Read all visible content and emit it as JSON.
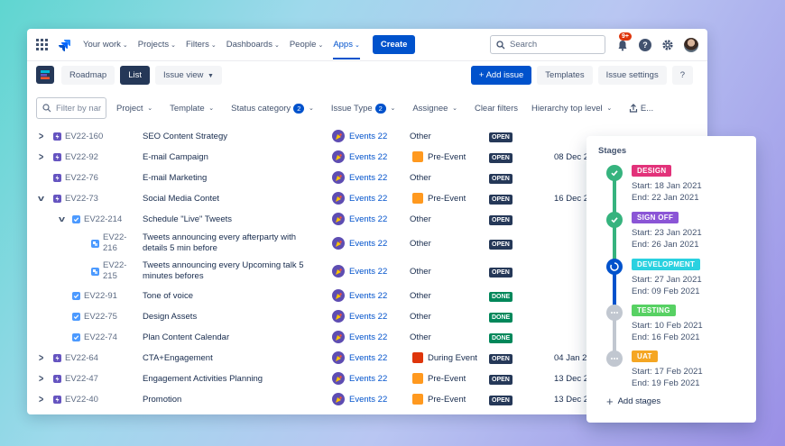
{
  "nav": {
    "items": [
      "Your work",
      "Projects",
      "Filters",
      "Dashboards",
      "People",
      "Apps"
    ],
    "create": "Create",
    "search_placeholder": "Search",
    "notif_count": "9+",
    "help": "?"
  },
  "toolbar": {
    "roadmap": "Roadmap",
    "list": "List",
    "issue_view": "Issue view",
    "add_issue": "+ Add issue",
    "templates": "Templates",
    "issue_settings": "Issue settings",
    "help": "?"
  },
  "filters": {
    "placeholder": "Filter by nar",
    "project": "Project",
    "template": "Template",
    "status_category": "Status category",
    "status_count": "2",
    "issue_type": "Issue Type",
    "issue_type_count": "2",
    "assignee": "Assignee",
    "clear": "Clear filters",
    "hierarchy": "Hierarchy top level",
    "export": "E..."
  },
  "rows": [
    {
      "expand": ">",
      "key": "EV22-160",
      "type": "epic",
      "summary": "SEO Content Strategy",
      "project": "Events 22",
      "template": "Other",
      "status": "OPEN",
      "date": ""
    },
    {
      "expand": ">",
      "key": "EV22-92",
      "type": "epic",
      "summary": "E-mail Campaign",
      "project": "Events 22",
      "template": "Pre-Event",
      "status": "OPEN",
      "date": "08 Dec 2"
    },
    {
      "expand": "",
      "key": "EV22-76",
      "type": "epic",
      "summary": "E-mail Marketing",
      "project": "Events 22",
      "template": "Other",
      "status": "OPEN",
      "date": ""
    },
    {
      "expand": "v",
      "key": "EV22-73",
      "type": "epic",
      "summary": "Social Media Contet",
      "project": "Events 22",
      "template": "Pre-Event",
      "status": "OPEN",
      "date": "16 Dec 2"
    },
    {
      "expand": "v",
      "key": "EV22-214",
      "type": "task",
      "summary": "Schedule \"Live\" Tweets",
      "project": "Events 22",
      "template": "Other",
      "status": "OPEN",
      "date": ""
    },
    {
      "expand": "",
      "key": "EV22-216",
      "type": "sub",
      "summary": "Tweets announcing every afterparty with details 5 min before",
      "project": "Events 22",
      "template": "Other",
      "status": "OPEN",
      "date": ""
    },
    {
      "expand": "",
      "key": "EV22-215",
      "type": "sub",
      "summary": "Tweets announcing every Upcoming talk 5 minutes befores",
      "project": "Events 22",
      "template": "Other",
      "status": "OPEN",
      "date": ""
    },
    {
      "expand": "",
      "key": "EV22-91",
      "type": "task",
      "summary": "Tone of voice",
      "project": "Events 22",
      "template": "Other",
      "status": "DONE",
      "date": ""
    },
    {
      "expand": "",
      "key": "EV22-75",
      "type": "task",
      "summary": "Design Assets",
      "project": "Events 22",
      "template": "Other",
      "status": "DONE",
      "date": ""
    },
    {
      "expand": "",
      "key": "EV22-74",
      "type": "task",
      "summary": "Plan Content Calendar",
      "project": "Events 22",
      "template": "Other",
      "status": "DONE",
      "date": ""
    },
    {
      "expand": ">",
      "key": "EV22-64",
      "type": "epic",
      "summary": "CTA+Engagement",
      "project": "Events 22",
      "template": "During Event",
      "status": "OPEN",
      "date": "04 Jan 2"
    },
    {
      "expand": ">",
      "key": "EV22-47",
      "type": "epic",
      "summary": "Engagement Activities Planning",
      "project": "Events 22",
      "template": "Pre-Event",
      "status": "OPEN",
      "date": "13 Dec 2"
    },
    {
      "expand": ">",
      "key": "EV22-40",
      "type": "epic",
      "summary": "Promotion",
      "project": "Events 22",
      "template": "Pre-Event",
      "status": "OPEN",
      "date": "13 Dec 2"
    }
  ],
  "stages": {
    "title": "Stages",
    "items": [
      {
        "name": "DESIGN",
        "color": "#e2327a",
        "state": "done",
        "start": "Start: 18 Jan 2021",
        "end": "End: 22 Jan 2021"
      },
      {
        "name": "SIGN OFF",
        "color": "#8b55d6",
        "state": "done",
        "start": "Start: 23 Jan 2021",
        "end": "End: 26 Jan 2021"
      },
      {
        "name": "DEVELOPMENT",
        "color": "#2ad1e0",
        "state": "current",
        "start": "Start: 27 Jan 2021",
        "end": "End: 09 Feb 2021"
      },
      {
        "name": "TESTING",
        "color": "#57d163",
        "state": "todo",
        "start": "Start: 10 Feb 2021",
        "end": "End: 16 Feb 2021"
      },
      {
        "name": "UAT",
        "color": "#f5a623",
        "state": "todo",
        "start": "Start: 17 Feb 2021",
        "end": "End: 19 Feb 2021"
      }
    ],
    "add": "Add stages"
  },
  "colors": {
    "accent": "#0052cc",
    "done": "#00875a",
    "green": "#36b37e",
    "blue": "#0052cc",
    "grey": "#c1c7d0"
  }
}
